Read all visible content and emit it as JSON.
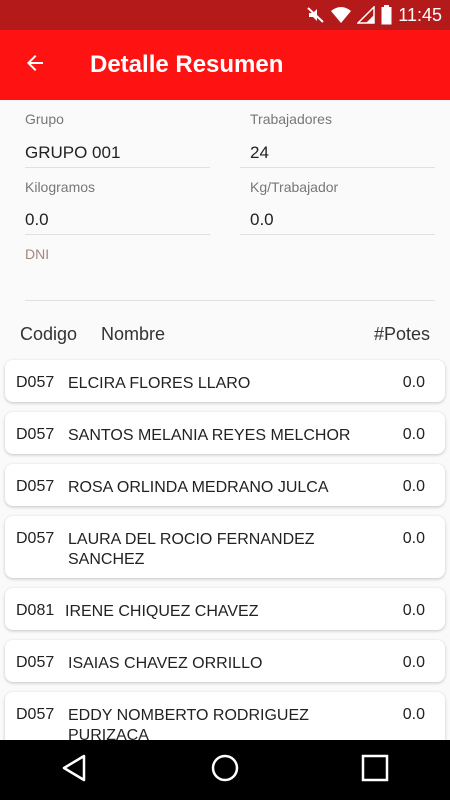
{
  "status": {
    "time": "11:45",
    "icons": [
      "mute-icon",
      "wifi-icon",
      "signal-icon",
      "battery-icon"
    ]
  },
  "app_bar": {
    "title": "Detalle Resumen",
    "back_icon": "back-arrow-icon"
  },
  "summary": {
    "grupo_label": "Grupo",
    "grupo_value": "GRUPO 001",
    "trabajadores_label": "Trabajadores",
    "trabajadores_value": "24",
    "kilogramos_label": "Kilogramos",
    "kilogramos_value": "0.0",
    "kg_trabajador_label": "Kg/Trabajador",
    "kg_trabajador_value": "0.0",
    "dni_label": "DNI"
  },
  "table": {
    "headers": {
      "codigo": "Codigo",
      "nombre": "Nombre",
      "potes": "#Potes"
    },
    "rows": [
      {
        "code": "D057",
        "name": "ELCIRA FLORES LLARO",
        "potes": "0.0"
      },
      {
        "code": "D057",
        "name": "SANTOS MELANIA REYES MELCHOR",
        "potes": "0.0"
      },
      {
        "code": "D057",
        "name": "ROSA ORLINDA MEDRANO JULCA",
        "potes": "0.0"
      },
      {
        "code": "D057",
        "name": "LAURA DEL ROCIO FERNANDEZ SANCHEZ",
        "potes": "0.0"
      },
      {
        "code": "D081",
        "name": "IRENE CHIQUEZ CHAVEZ",
        "potes": "0.0"
      },
      {
        "code": "D057",
        "name": "ISAIAS CHAVEZ ORRILLO",
        "potes": "0.0"
      },
      {
        "code": "D057",
        "name": "EDDY NOMBERTO RODRIGUEZ PURIZACA",
        "potes": "0.0"
      }
    ]
  },
  "colors": {
    "app_bar": "#ff1212",
    "status_bar": "#b51a1a",
    "dni_label": "#a1887f"
  },
  "nav": {
    "icons": [
      "back-triangle-icon",
      "home-circle-icon",
      "recents-square-icon"
    ]
  }
}
